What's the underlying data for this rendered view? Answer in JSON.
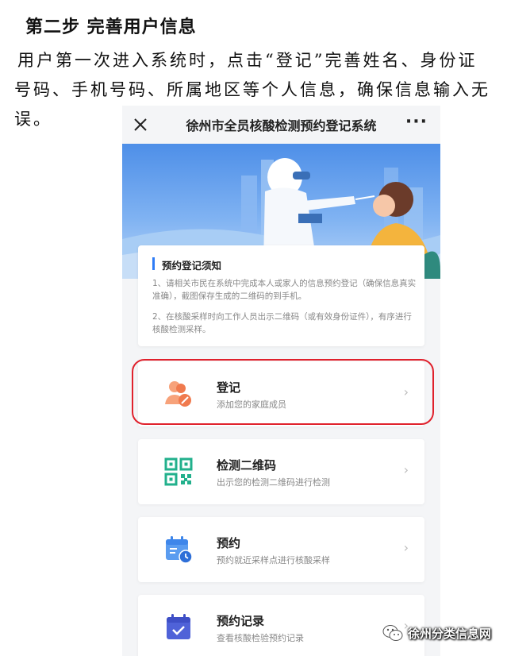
{
  "document": {
    "heading": "第二步 完善用户信息",
    "paragraph": "用户第一次进入系统时，点击“登记”完善姓名、身份证号码、手机号码、所属地区等个人信息，确保信息输入无误。"
  },
  "app": {
    "title": "徐州市全员核酸检测预约登记系统",
    "more_label": "···"
  },
  "notice": {
    "title": "预约登记须知",
    "items": [
      "1、请相关市民在系统中完成本人或家人的信息预约登记（确保信息真实准确），截图保存生成的二维码的到手机。",
      "2、在核酸采样时向工作人员出示二维码（或有效身份证件），有序进行核酸检测采样。"
    ]
  },
  "menu": [
    {
      "title": "登记",
      "subtitle": "添加您的家庭成员",
      "icon": "family-user-icon"
    },
    {
      "title": "检测二维码",
      "subtitle": "出示您的检测二维码进行检测",
      "icon": "qr-code-icon"
    },
    {
      "title": "预约",
      "subtitle": "预约就近采样点进行核酸采样",
      "icon": "calendar-clock-icon"
    },
    {
      "title": "预约记录",
      "subtitle": "查看核酸检验预约记录",
      "icon": "calendar-check-icon"
    }
  ],
  "watermark": {
    "text": "徐州分类信息网",
    "icon": "wechat-icon"
  },
  "colors": {
    "accent_blue": "#2e7cf6",
    "register_orange": "#f07a4e",
    "qr_green": "#22b08c",
    "highlight_red": "#e0212c"
  }
}
